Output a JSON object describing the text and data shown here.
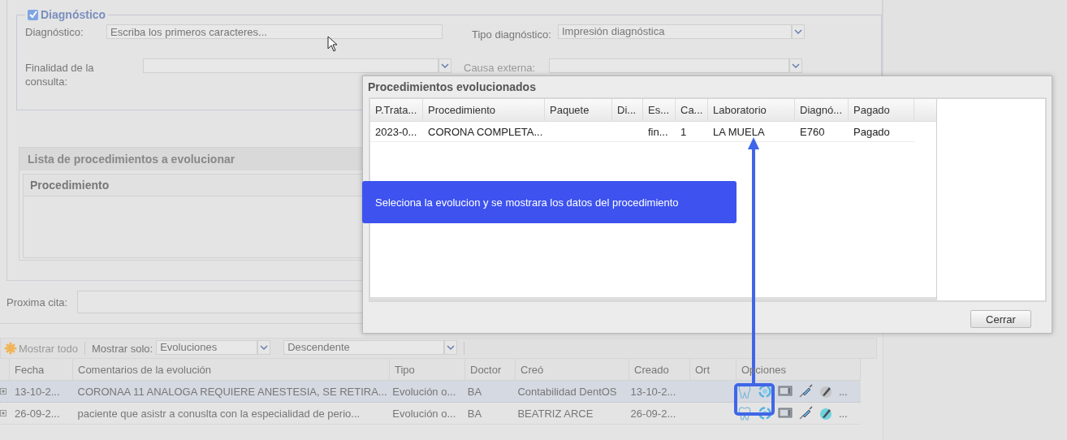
{
  "diagnosis_section": {
    "title": "Diagnóstico",
    "checked": true,
    "diagnosis_label": "Diagnóstico:",
    "diagnosis_placeholder": "Escriba los primeros caracteres...",
    "type_label": "Tipo diagnóstico:",
    "type_value": "Impresión diagnóstica",
    "purpose_label": "Finalidad de la consulta:",
    "cause_label": "Causa externa:"
  },
  "procedures_panel": {
    "title": "Lista de procedimientos a evolucionar",
    "column": "Procedimiento"
  },
  "next_appointment": {
    "label": "Proxima cita:"
  },
  "toolbar": {
    "show_all": "Mostrar todo",
    "show_only_label": "Mostrar solo:",
    "show_only_value": "Evoluciones",
    "order_value": "Descendente"
  },
  "evolutions": {
    "columns": [
      "Fecha",
      "Comentarios de la evolución",
      "Tipo",
      "Doctor",
      "Creó",
      "Creado",
      "Ort",
      "Opciones"
    ],
    "rows": [
      {
        "selected": true,
        "fecha": "13-10-2...",
        "comentarios": "CORONAA 11 ANALOGA REQUIERE ANESTESIA, SE RETIRA...",
        "tipo": "Evolución o...",
        "doctor": "BA",
        "creo": "Contabilidad DentOS",
        "creado": "13-10-2...",
        "pen_active": false,
        "more": "..."
      },
      {
        "selected": false,
        "fecha": "26-09-2...",
        "comentarios": "paciente que asistr a conuslta con la especialidad de perio...",
        "tipo": "Evolución o...",
        "doctor": "BA",
        "creo": "BEATRIZ ARCE",
        "creado": "26-09-2...",
        "pen_active": true,
        "more": "..."
      }
    ]
  },
  "modal": {
    "title": "Procedimientos evolucionados",
    "columns": [
      "P.Trata...",
      "Procedimiento",
      "Paquete",
      "Di...",
      "Es...",
      "Ca...",
      "Laboratorio",
      "Diagnó...",
      "Pagado"
    ],
    "rows": [
      {
        "p_trata": "2023-0...",
        "procedimiento": "CORONA COMPLETA...",
        "es": "fin...",
        "ca": "1",
        "laboratorio": "LA MUELA",
        "diagnostico": "E760",
        "pagado": "Pagado"
      }
    ],
    "close_button": "Cerrar"
  },
  "callout": {
    "text": "Seleciona la evolucion y se mostrara los datos del procedimiento"
  }
}
